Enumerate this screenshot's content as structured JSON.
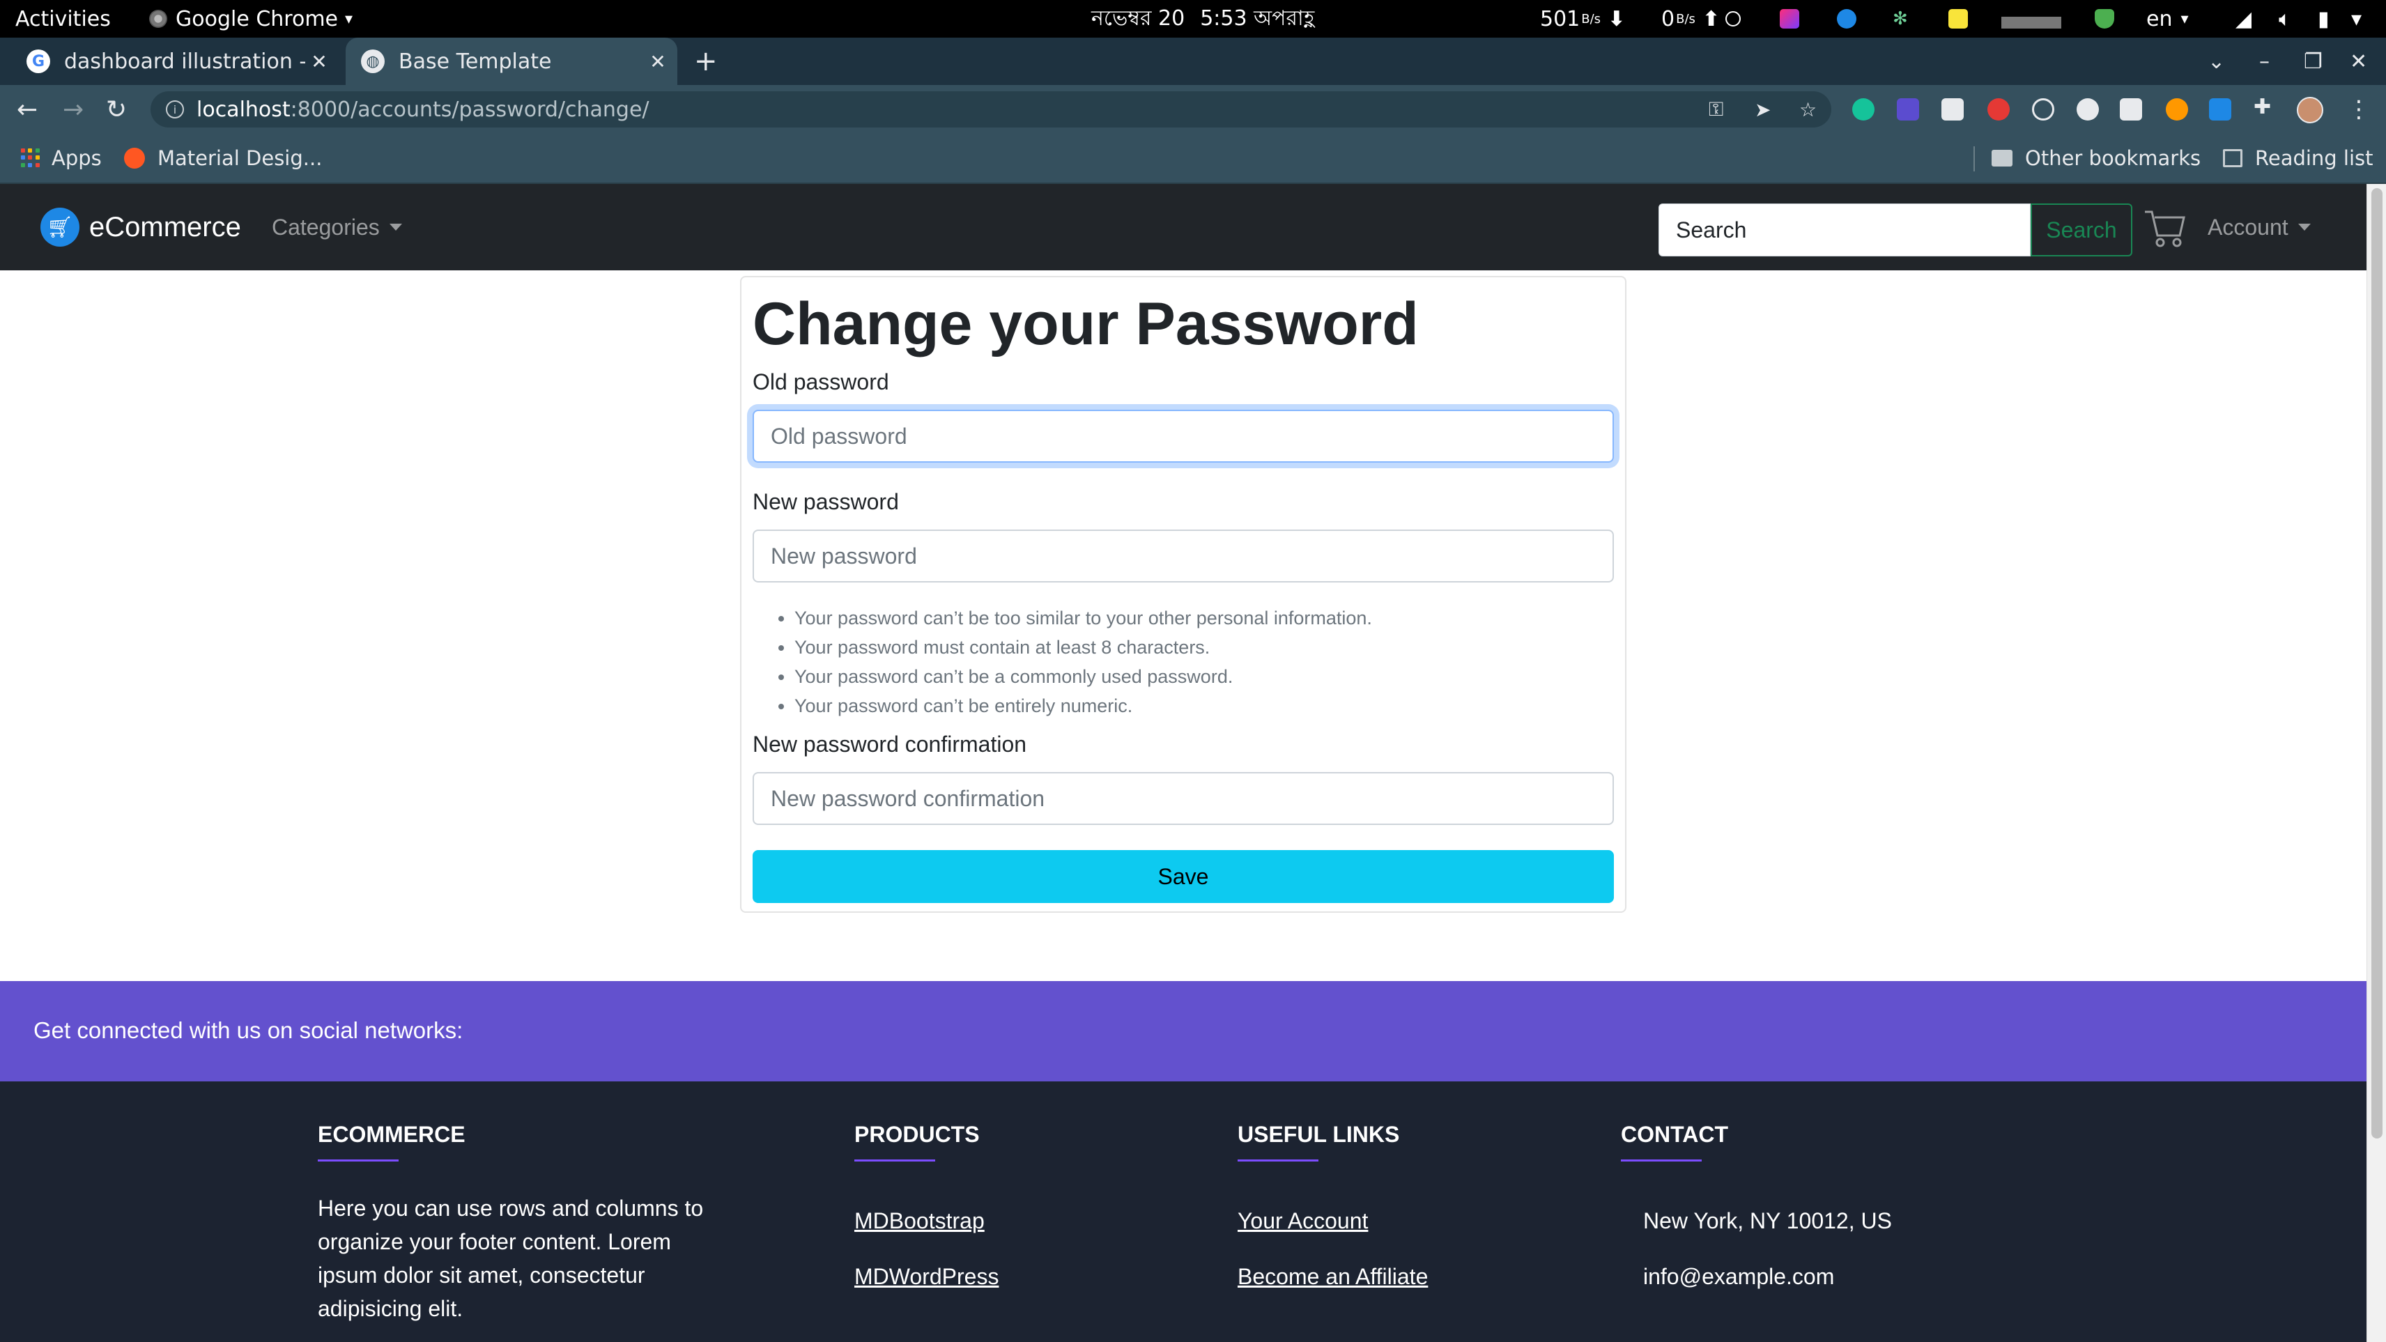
{
  "os_bar": {
    "activities": "Activities",
    "app_name": "Google Chrome",
    "date": "নভেম্বর 20",
    "time": "5:53 অপরাহ্ণ",
    "net_down": "501",
    "net_down_unit": "B/s",
    "net_up": "0",
    "net_up_unit": "B/s",
    "language": "en"
  },
  "browser": {
    "tabs": [
      {
        "title": "dashboard illustration - Go",
        "favicon": "google-icon"
      },
      {
        "title": "Base Template",
        "favicon": "globe-icon",
        "active": true
      }
    ],
    "url_host": "localhost",
    "url_path": ":8000/accounts/password/change/",
    "bookmarks": {
      "apps": "Apps",
      "material": "Material Desig...",
      "other": "Other bookmarks",
      "reading": "Reading list"
    }
  },
  "site": {
    "brand": "eCommerce",
    "nav": {
      "categories": "Categories",
      "search_placeholder": "Search",
      "search_button": "Search",
      "account": "Account"
    },
    "form": {
      "title": "Change your Password",
      "old_label": "Old password",
      "old_placeholder": "Old password",
      "new_label": "New password",
      "new_placeholder": "New password",
      "help": [
        "Your password can’t be too similar to your other personal information.",
        "Your password must contain at least 8 characters.",
        "Your password can’t be a commonly used password.",
        "Your password can’t be entirely numeric."
      ],
      "confirm_label": "New password confirmation",
      "confirm_placeholder": "New password confirmation",
      "save": "Save"
    },
    "social_text": "Get connected with us on social networks:",
    "footer": {
      "ecommerce": {
        "heading": "ECOMMERCE",
        "text": "Here you can use rows and columns to organize your footer content. Lorem ipsum dolor sit amet, consectetur adipisicing elit."
      },
      "products": {
        "heading": "PRODUCTS",
        "links": [
          "MDBootstrap",
          "MDWordPress"
        ]
      },
      "useful": {
        "heading": "USEFUL LINKS",
        "links": [
          "Your Account",
          "Become an Affiliate"
        ]
      },
      "contact": {
        "heading": "CONTACT",
        "address": "New York, NY 10012, US",
        "email": "info@example.com"
      }
    }
  },
  "colors": {
    "navbar": "#212529",
    "save_button": "#0dcaf0",
    "social_band": "#6351ce",
    "footer": "#1c2331",
    "search_button": "#198754"
  }
}
